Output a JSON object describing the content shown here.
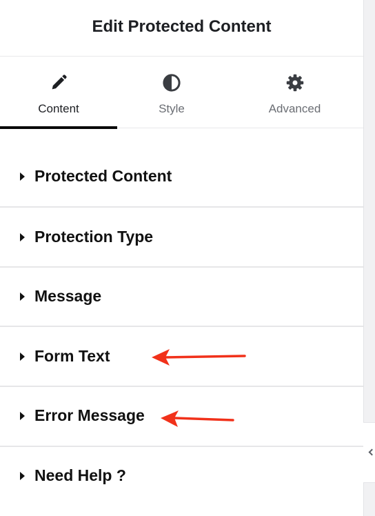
{
  "header": {
    "title": "Edit Protected Content"
  },
  "tabs": [
    {
      "label": "Content",
      "icon": "pencil-icon",
      "active": true
    },
    {
      "label": "Style",
      "icon": "contrast-icon",
      "active": false
    },
    {
      "label": "Advanced",
      "icon": "gear-icon",
      "active": false
    }
  ],
  "sections": [
    {
      "label": "Protected Content"
    },
    {
      "label": "Protection Type"
    },
    {
      "label": "Message"
    },
    {
      "label": "Form Text"
    },
    {
      "label": "Error Message"
    },
    {
      "label": "Need Help ?"
    }
  ],
  "annotations": {
    "arrow_color": "#f1311a"
  },
  "colors": {
    "text_primary": "#1d1f23",
    "text_secondary": "#6a6d73",
    "active_underline": "#0a0a0a",
    "divider": "#e6e6e8"
  }
}
